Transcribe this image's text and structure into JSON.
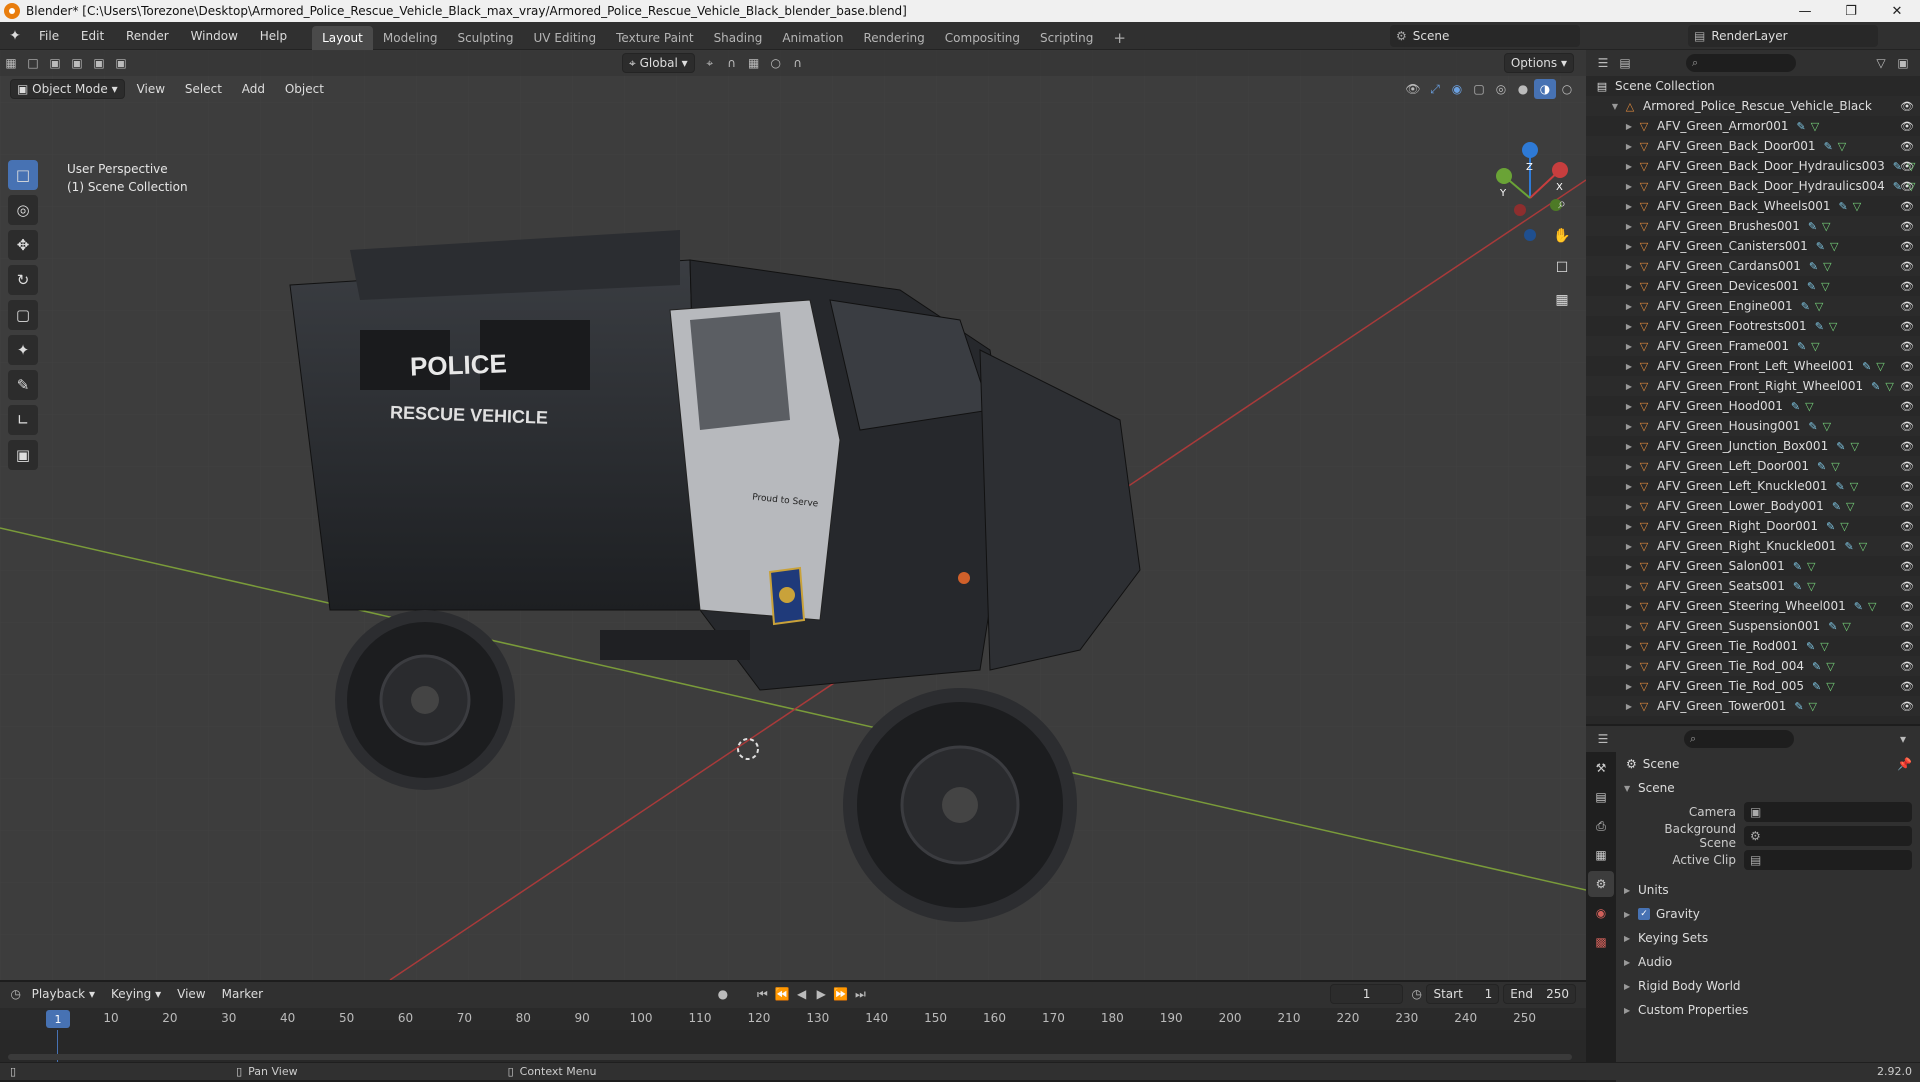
{
  "window": {
    "title": "Blender* [C:\\Users\\Torezone\\Desktop\\Armored_Police_Rescue_Vehicle_Black_max_vray/Armored_Police_Rescue_Vehicle_Black_blender_base.blend]",
    "min_icon": "minimize-icon",
    "max_icon": "maximize-icon",
    "close_icon": "close-icon"
  },
  "menu": [
    "File",
    "Edit",
    "Render",
    "Window",
    "Help"
  ],
  "workspaces": [
    "Layout",
    "Modeling",
    "Sculpting",
    "UV Editing",
    "Texture Paint",
    "Shading",
    "Animation",
    "Rendering",
    "Compositing",
    "Scripting"
  ],
  "active_workspace": "Layout",
  "scene_name": "Scene",
  "view_layer": "RenderLayer",
  "viewport": {
    "mode": "Object Mode",
    "menus": [
      "View",
      "Select",
      "Add",
      "Object"
    ],
    "orientation": "Global",
    "options_label": "Options",
    "info_line1": "User Perspective",
    "info_line2": "(1) Scene Collection",
    "gizmo_axes": [
      "X",
      "Y",
      "Z"
    ],
    "decal_title": "POLICE",
    "decal_sub": "RESCUE VEHICLE",
    "motto": "Proud to Serve"
  },
  "outliner": {
    "root": "Scene Collection",
    "collection": "Armored_Police_Rescue_Vehicle_Black",
    "objects": [
      "AFV_Green_Armor001",
      "AFV_Green_Back_Door001",
      "AFV_Green_Back_Door_Hydraulics003",
      "AFV_Green_Back_Door_Hydraulics004",
      "AFV_Green_Back_Wheels001",
      "AFV_Green_Brushes001",
      "AFV_Green_Canisters001",
      "AFV_Green_Cardans001",
      "AFV_Green_Devices001",
      "AFV_Green_Engine001",
      "AFV_Green_Footrests001",
      "AFV_Green_Frame001",
      "AFV_Green_Front_Left_Wheel001",
      "AFV_Green_Front_Right_Wheel001",
      "AFV_Green_Hood001",
      "AFV_Green_Housing001",
      "AFV_Green_Junction_Box001",
      "AFV_Green_Left_Door001",
      "AFV_Green_Left_Knuckle001",
      "AFV_Green_Lower_Body001",
      "AFV_Green_Right_Door001",
      "AFV_Green_Right_Knuckle001",
      "AFV_Green_Salon001",
      "AFV_Green_Seats001",
      "AFV_Green_Steering_Wheel001",
      "AFV_Green_Suspension001",
      "AFV_Green_Tie_Rod001",
      "AFV_Green_Tie_Rod_004",
      "AFV_Green_Tie_Rod_005",
      "AFV_Green_Tower001"
    ]
  },
  "properties": {
    "context": "Scene",
    "panel": "Scene",
    "camera_label": "Camera",
    "bg_scene_label": "Background Scene",
    "active_clip_label": "Active Clip",
    "sections": [
      "Units",
      "Gravity",
      "Keying Sets",
      "Audio",
      "Rigid Body World",
      "Custom Properties"
    ],
    "gravity_checked": true
  },
  "timeline": {
    "menus": [
      "Playback",
      "Keying",
      "View",
      "Marker"
    ],
    "current_frame": "1",
    "start_label": "Start",
    "start": "1",
    "end_label": "End",
    "end": "250",
    "ticks": [
      "10",
      "20",
      "30",
      "40",
      "50",
      "60",
      "70",
      "80",
      "90",
      "100",
      "110",
      "120",
      "130",
      "140",
      "150",
      "160",
      "170",
      "180",
      "190",
      "200",
      "210",
      "220",
      "230",
      "240",
      "250"
    ]
  },
  "status": {
    "pan": "Pan View",
    "context": "Context Menu",
    "version": "2.92.0"
  }
}
